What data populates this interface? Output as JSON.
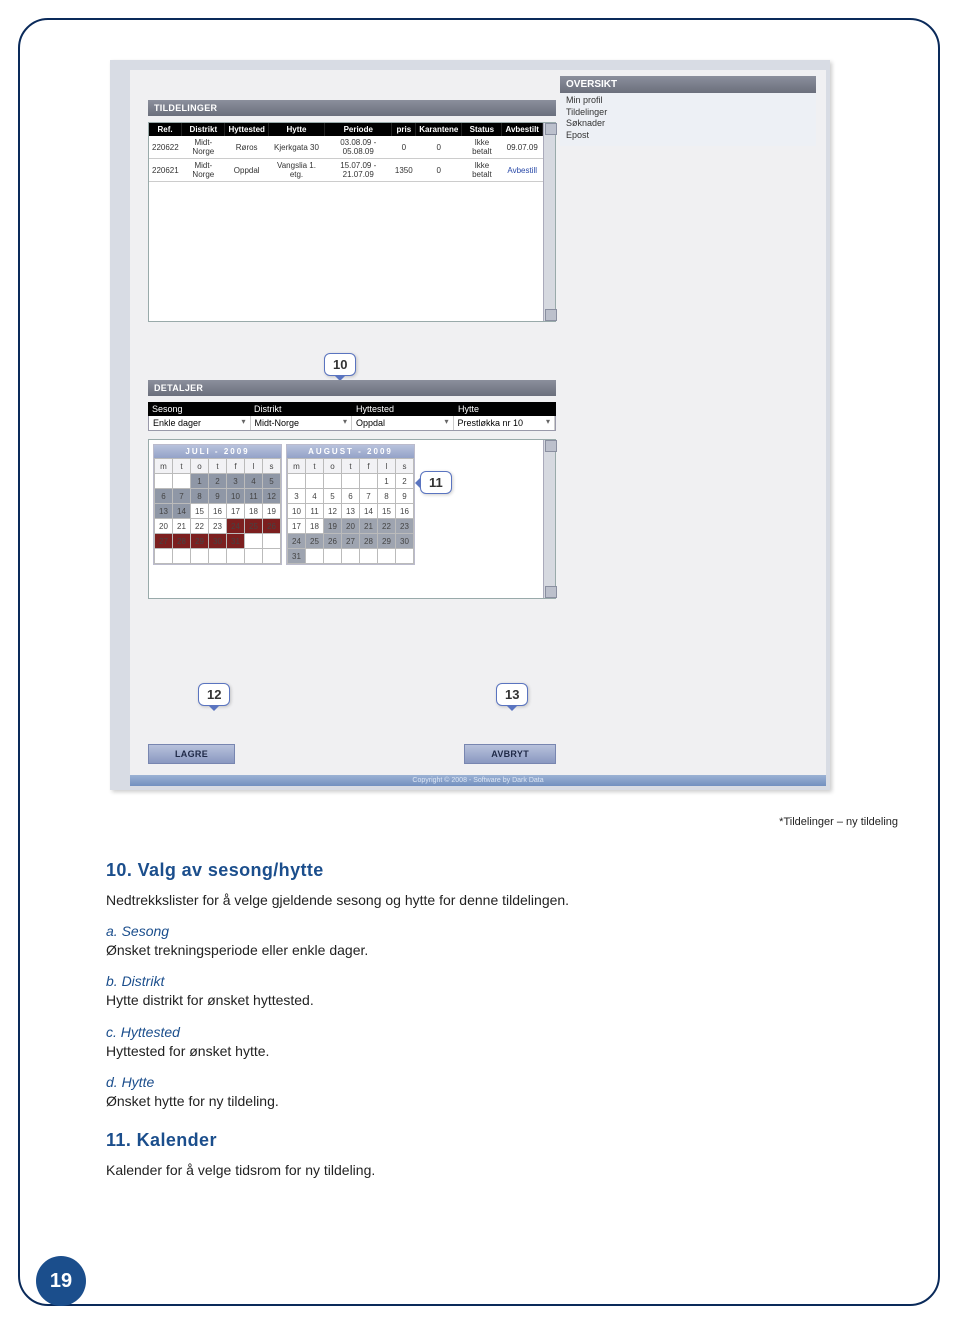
{
  "sidebar": {
    "title": "OVERSIKT",
    "items": [
      "Min profil",
      "Tildelinger",
      "Søknader",
      "Epost"
    ]
  },
  "tildelinger": {
    "title": "TILDELINGER",
    "headers": [
      "Ref.",
      "Distrikt",
      "Hyttested",
      "Hytte",
      "Periode",
      "pris",
      "Karantene",
      "Status",
      "Avbestilt"
    ],
    "rows": [
      {
        "ref": "220622",
        "distrikt": "Midt-Norge",
        "hyttested": "Røros",
        "hytte": "Kjerkgata 30",
        "periode": "03.08.09 - 05.08.09",
        "pris": "0",
        "karantene": "0",
        "status": "Ikke betalt",
        "avbestilt": "09.07.09",
        "link": false
      },
      {
        "ref": "220621",
        "distrikt": "Midt-Norge",
        "hyttested": "Oppdal",
        "hytte": "Vangslia 1. etg.",
        "periode": "15.07.09 - 21.07.09",
        "pris": "1350",
        "karantene": "0",
        "status": "Ikke betalt",
        "avbestilt": "Avbestill",
        "link": true
      }
    ]
  },
  "detaljer": {
    "title": "DETALJER",
    "labels": [
      "Sesong",
      "Distrikt",
      "Hyttested",
      "Hytte"
    ],
    "values": [
      "Enkle dager",
      "Midt-Norge",
      "Oppdal",
      "Prestløkka nr 10"
    ]
  },
  "calendars": {
    "juli": {
      "title": "JULI - 2009",
      "weekdays": [
        "m",
        "t",
        "o",
        "t",
        "f",
        "l",
        "s"
      ]
    },
    "august": {
      "title": "AUGUST - 2009",
      "weekdays": [
        "m",
        "t",
        "o",
        "t",
        "f",
        "l",
        "s"
      ]
    }
  },
  "callouts": {
    "c10": "10",
    "c11": "11",
    "c12": "12",
    "c13": "13"
  },
  "buttons": {
    "lagre": "LAGRE",
    "avbryt": "AVBRYT"
  },
  "copyright": "Copyright © 2008 - Software by Dark Data",
  "caption": "*Tildelinger – ny tildeling",
  "doc": {
    "h10": "10. Valg av sesong/hytte",
    "p10": "Nedtrekkslister for å velge gjeldende sesong og hytte for denne tildelingen.",
    "sa": "a. Sesong",
    "pa": "Ønsket trekningsperiode eller enkle dager.",
    "sb": "b. Distrikt",
    "pb": "Hytte distrikt for ønsket hyttested.",
    "sc": "c. Hyttested",
    "pc": "Hyttested for ønsket hytte.",
    "sd": "d. Hytte",
    "pd": "Ønsket hytte for ny tildeling.",
    "h11": "11. Kalender",
    "p11": "Kalender for å velge tidsrom for ny tildeling."
  },
  "page": "19"
}
